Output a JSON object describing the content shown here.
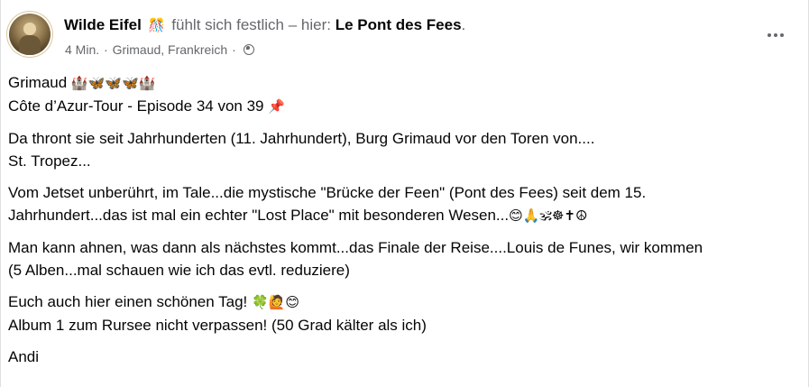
{
  "post": {
    "author": "Wilde Eifel",
    "feeling_emoji": "🎊",
    "feeling_text": "fühlt sich festlich – hier:",
    "location": "Le Pont des Fees",
    "period": ".",
    "time": "4 Min.",
    "separator": "·",
    "place": "Grimaud, Frankreich",
    "separator2": "·",
    "audience_icon": "globe-icon",
    "more_icon": "more-horizontal-icon"
  },
  "content": {
    "p1_line1_text": "Grimaud",
    "p1_line1_emoji": "🏰🦋🦋🦋🏰",
    "p1_line2_text": "Côte d’Azur-Tour - Episode 34 von 39",
    "p1_line2_emoji": "📌",
    "p2_line1": "Da thront sie seit Jahrhunderten (11. Jahrhundert), Burg Grimaud vor den Toren von....",
    "p2_line2": "St. Tropez...",
    "p3_line1": "Vom Jetset unberührt, im Tale...die mystische \"Brücke der Feen\" (Pont des Fees) seit dem 15.",
    "p3_line2_text": "Jahrhundert...das ist mal ein echter \"Lost Place\" mit besonderen Wesen...",
    "p3_line2_emoji": "😊🙏🕉☸✝☮",
    "p4_line1": "Man kann ahnen, was dann als nächstes kommt...das Finale der Reise....Louis de Funes, wir kommen",
    "p4_line2": "(5 Alben...mal schauen wie ich das evtl. reduziere)",
    "p5_line1_text": "Euch auch hier einen schönen Tag!",
    "p5_line1_emoji": "🍀🙋😊",
    "p5_line2": "Album 1 zum Rursee nicht verpassen! (50 Grad kälter als ich)",
    "p6_line1": "Andi"
  }
}
